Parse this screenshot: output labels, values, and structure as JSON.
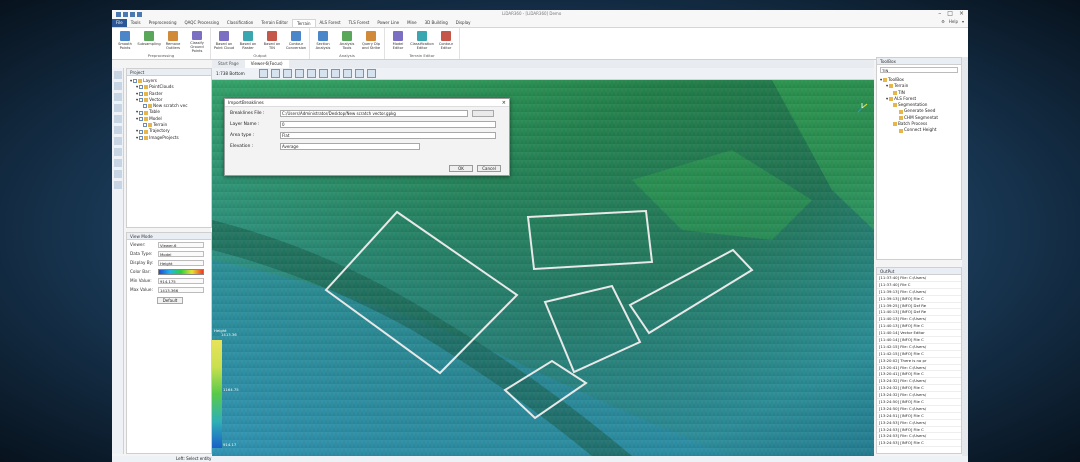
{
  "window": {
    "title": "LiDAR360 - [LiDAR360] Demo"
  },
  "ribbon_tabs": [
    "File",
    "Tools",
    "Preprocessing",
    "QAQC Processing",
    "Classification",
    "Terrain Editor",
    "Terrain",
    "ALS Forest",
    "TLS Forest",
    "Power Line",
    "Mine",
    "3D Building",
    "Display"
  ],
  "active_tab": "Terrain",
  "top_right": {
    "help": "Help",
    "menu": "▾"
  },
  "ribbon_groups": [
    {
      "label": "Preprocessing",
      "buttons": [
        "Smooth Points",
        "Subsampling",
        "Remove Outliers",
        "Classify Ground Points"
      ]
    },
    {
      "label": "Output",
      "buttons": [
        "Based on Point Cloud",
        "Based on Raster",
        "Based on TIN",
        "Contour Conversion"
      ]
    },
    {
      "label": "Analysis",
      "buttons": [
        "Section Analysis",
        "Analysis Tools",
        "Query Dip and Strike"
      ]
    },
    {
      "label": "Terrain Editor",
      "buttons": [
        "Model Editor",
        "Classification Editor",
        "Contour Editor"
      ]
    }
  ],
  "project_panel": {
    "title": "Project",
    "tree": [
      {
        "label": "Layers",
        "level": 0
      },
      {
        "label": "PointClouds",
        "level": 1
      },
      {
        "label": "Raster",
        "level": 1
      },
      {
        "label": "Vector",
        "level": 1
      },
      {
        "label": "New scratch vec",
        "level": 2
      },
      {
        "label": "Table",
        "level": 1
      },
      {
        "label": "Model",
        "level": 1
      },
      {
        "label": "Terrain",
        "level": 2
      },
      {
        "label": "Trajectory",
        "level": 1
      },
      {
        "label": "ImageProjects",
        "level": 1
      }
    ]
  },
  "view_mode": {
    "title": "View Mode",
    "rows": [
      {
        "key": "Viewer:",
        "value": "Viewer-6"
      },
      {
        "key": "Data Type:",
        "value": "Model"
      },
      {
        "key": "Display By:",
        "value": "Height"
      },
      {
        "key": "Color Bar:",
        "value": ""
      },
      {
        "key": "Min Value:",
        "value": "914.175"
      },
      {
        "key": "Max Value:",
        "value": "1413.366"
      }
    ],
    "default_button": "Default"
  },
  "doc_tabs": [
    "Start Page",
    "Viewer-6(Focus)"
  ],
  "active_doc_tab": "Viewer-6(Focus)",
  "view_scale": "1:738 Bottom",
  "legend": {
    "title": "Height",
    "max": "1413.36",
    "mid": "1164.75",
    "min": "914.17"
  },
  "dialog": {
    "title": "ImportBreaklines",
    "rows": [
      {
        "key": "Breaklines File :",
        "value": "C:/Users/Administrator/Desktop/New scratch vector.gpkg"
      },
      {
        "key": "Layer Name :",
        "value": "0"
      },
      {
        "key": "Area type :",
        "value": "Flat"
      },
      {
        "key": "Elevation :",
        "value": "Average"
      }
    ],
    "ok": "OK",
    "cancel": "Cancel"
  },
  "toolbox": {
    "title": "ToolBox",
    "search_placeholder": "TIN",
    "tree": [
      {
        "label": "ToolBox",
        "level": 0
      },
      {
        "label": "Terrain",
        "level": 1
      },
      {
        "label": "TIN",
        "level": 2
      },
      {
        "label": "ALS Forest",
        "level": 1
      },
      {
        "label": "Segmentation",
        "level": 2
      },
      {
        "label": "Generate Seed",
        "level": 3
      },
      {
        "label": "CHM Segmentat",
        "level": 3
      },
      {
        "label": "Batch Process",
        "level": 2
      },
      {
        "label": "Connect Height",
        "level": 3
      }
    ]
  },
  "output": {
    "title": "OutPut",
    "lines": [
      "[11:37:40] File: C:/Users/",
      "[11:37:40]    File C",
      "[11:39:13] File: C:/Users/",
      "[11:39:13] [INFO]  File C",
      "[11:39:25] [INFO]  Dxf Re",
      "[11:40:13] [INFO]  Dxf Re",
      "[11:40:13] File: C:/Users/",
      "[11:40:13] [INFO]  File C",
      "[11:40:14] Vector Editor",
      "[11:40:14] [INFO]  File C",
      "[11:42:15] File: C:/Users/",
      "[11:42:15] [INFO]  File C",
      "[13:20:02] There is no pr",
      "[13:20:41] File: C:/Users/",
      "[13:20:41] [INFO]  File C",
      "[13:24:32] File: C:/Users/",
      "[13:24:32] [INFO]  File C",
      "[13:24:32] File: C:/Users/",
      "[13:24:50] [INFO]  File C",
      "[13:24:50] File: C:/Users/",
      "[13:24:51] [INFO]  File C",
      "[13:24:53] File: C:/Users/",
      "[13:24:53] [INFO]  File C",
      "[13:24:53] File: C:/Users/",
      "[13:24:53] [INFO]  File C"
    ]
  },
  "status": "Left: Select entity",
  "colors": {
    "accent": "#2b5797",
    "terrain_high": "#2f9e4a",
    "terrain_low": "#2a8fb5"
  }
}
